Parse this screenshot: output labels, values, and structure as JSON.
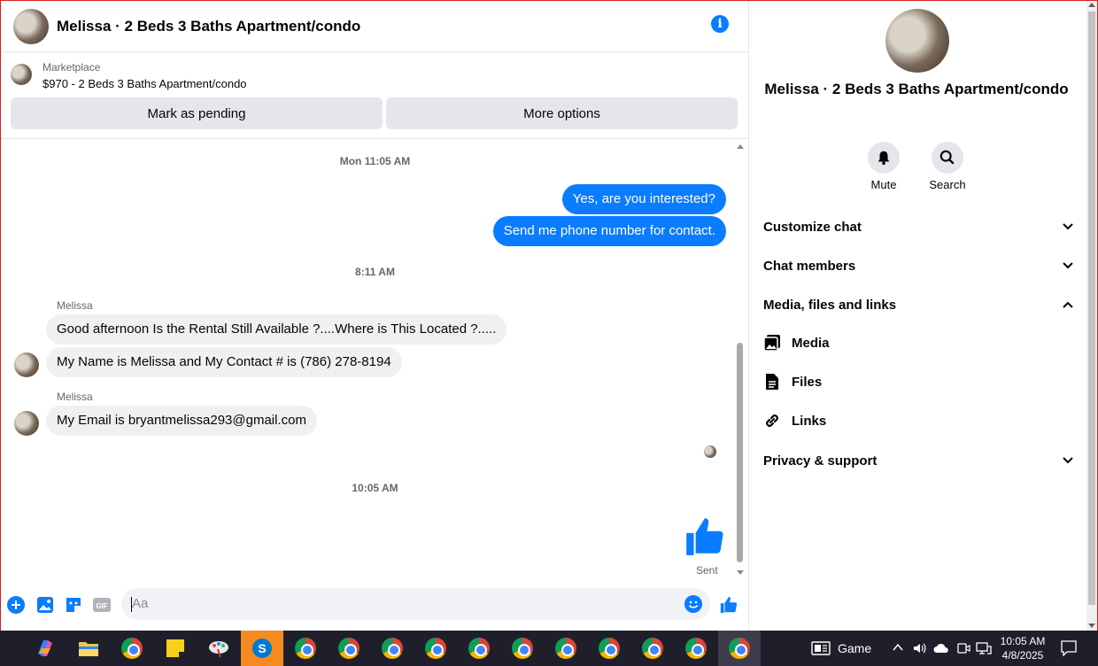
{
  "chat": {
    "title": "Melissa · 2 Beds 3 Baths Apartment/condo",
    "marketplace_label": "Marketplace",
    "listing": "$970 - 2 Beds 3 Baths Apartment/condo",
    "mark_pending": "Mark as pending",
    "more_options": "More options"
  },
  "messages": {
    "ts1": "Mon 11:05 AM",
    "out1": "Yes, are you interested?",
    "out2": "Send me phone number for contact.",
    "ts2": "8:11 AM",
    "sender1": "Melissa",
    "in1": "Good afternoon  Is the Rental Still Available ?....Where is This Located ?.....",
    "in2": "My Name is Melissa  and My Contact # is (786) 278-8194",
    "sender2": "Melissa",
    "in3": "My Email is bryantmelissa293@gmail.com",
    "ts3": "10:05 AM",
    "sent": "Sent"
  },
  "composer": {
    "placeholder": "Aa"
  },
  "side": {
    "name": "Melissa · 2 Beds 3 Baths Apartment/condo",
    "mute": "Mute",
    "search": "Search",
    "customize": "Customize chat",
    "members": "Chat members",
    "media_files": "Media, files and links",
    "media": "Media",
    "files": "Files",
    "links": "Links",
    "privacy": "Privacy & support"
  },
  "taskbar": {
    "game": "Game",
    "time": "10:05 AM",
    "date": "4/8/2025"
  },
  "colors": {
    "accent": "#0a7cff",
    "bubble_in": "#f0f0f0",
    "taskbar": "#1f1f2b"
  }
}
